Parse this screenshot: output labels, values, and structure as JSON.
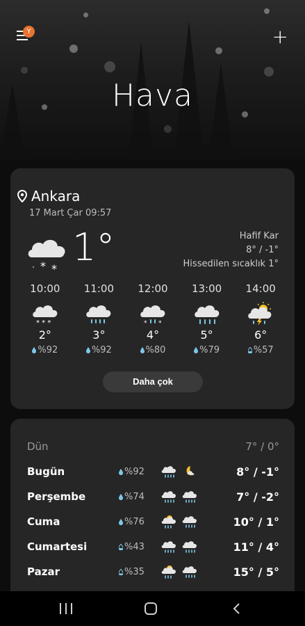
{
  "app": {
    "title": "Hava"
  },
  "header": {
    "menu_icon": "menu-icon",
    "badge": "Y",
    "add_icon": "plus-icon"
  },
  "current": {
    "location": "Ankara",
    "datetime": "17 Mart Çar 09:57",
    "temperature": "1°",
    "condition": "Hafif Kar",
    "high_low": "8° / -1°",
    "feels_like": "Hissedilen sıcaklık 1°",
    "icon": "light-snow-icon"
  },
  "hourly": [
    {
      "time": "10:00",
      "icon": "snow-icon",
      "temp": "2°",
      "humidity": "%92"
    },
    {
      "time": "11:00",
      "icon": "sleet-icon",
      "temp": "3°",
      "humidity": "%92"
    },
    {
      "time": "12:00",
      "icon": "sleet-icon",
      "temp": "4°",
      "humidity": "%80"
    },
    {
      "time": "13:00",
      "icon": "rain-icon",
      "temp": "5°",
      "humidity": "%79"
    },
    {
      "time": "14:00",
      "icon": "thunderstorm-sun-icon",
      "temp": "6°",
      "humidity": "%57"
    }
  ],
  "more_button": "Daha çok",
  "daily": [
    {
      "day": "Dün",
      "humidity": "",
      "icons": [],
      "temps": "7° / 0°"
    },
    {
      "day": "Bugün",
      "humidity": "%92",
      "icons": [
        "sleet-icon",
        "moon-icon"
      ],
      "temps": "8° / -1°"
    },
    {
      "day": "Perşembe",
      "humidity": "%74",
      "icons": [
        "sleet-icon",
        "sleet-icon"
      ],
      "temps": "7° / -2°"
    },
    {
      "day": "Cuma",
      "humidity": "%76",
      "icons": [
        "sun-rain-icon",
        "sleet-icon"
      ],
      "temps": "10° / 1°"
    },
    {
      "day": "Cumartesi",
      "humidity": "%43",
      "icons": [
        "sleet-icon",
        "sleet-icon"
      ],
      "temps": "11° / 4°"
    },
    {
      "day": "Pazar",
      "humidity": "%35",
      "icons": [
        "sun-rain-icon",
        "sleet-icon"
      ],
      "temps": "15° / 5°"
    }
  ],
  "navbar": {
    "recent_icon": "recent-apps-icon",
    "home_icon": "home-icon",
    "back_icon": "back-icon"
  },
  "colors": {
    "badge": "#e8742f",
    "card": "#262626",
    "background": "#0d0d0d",
    "drop": "#7fc8e8"
  }
}
